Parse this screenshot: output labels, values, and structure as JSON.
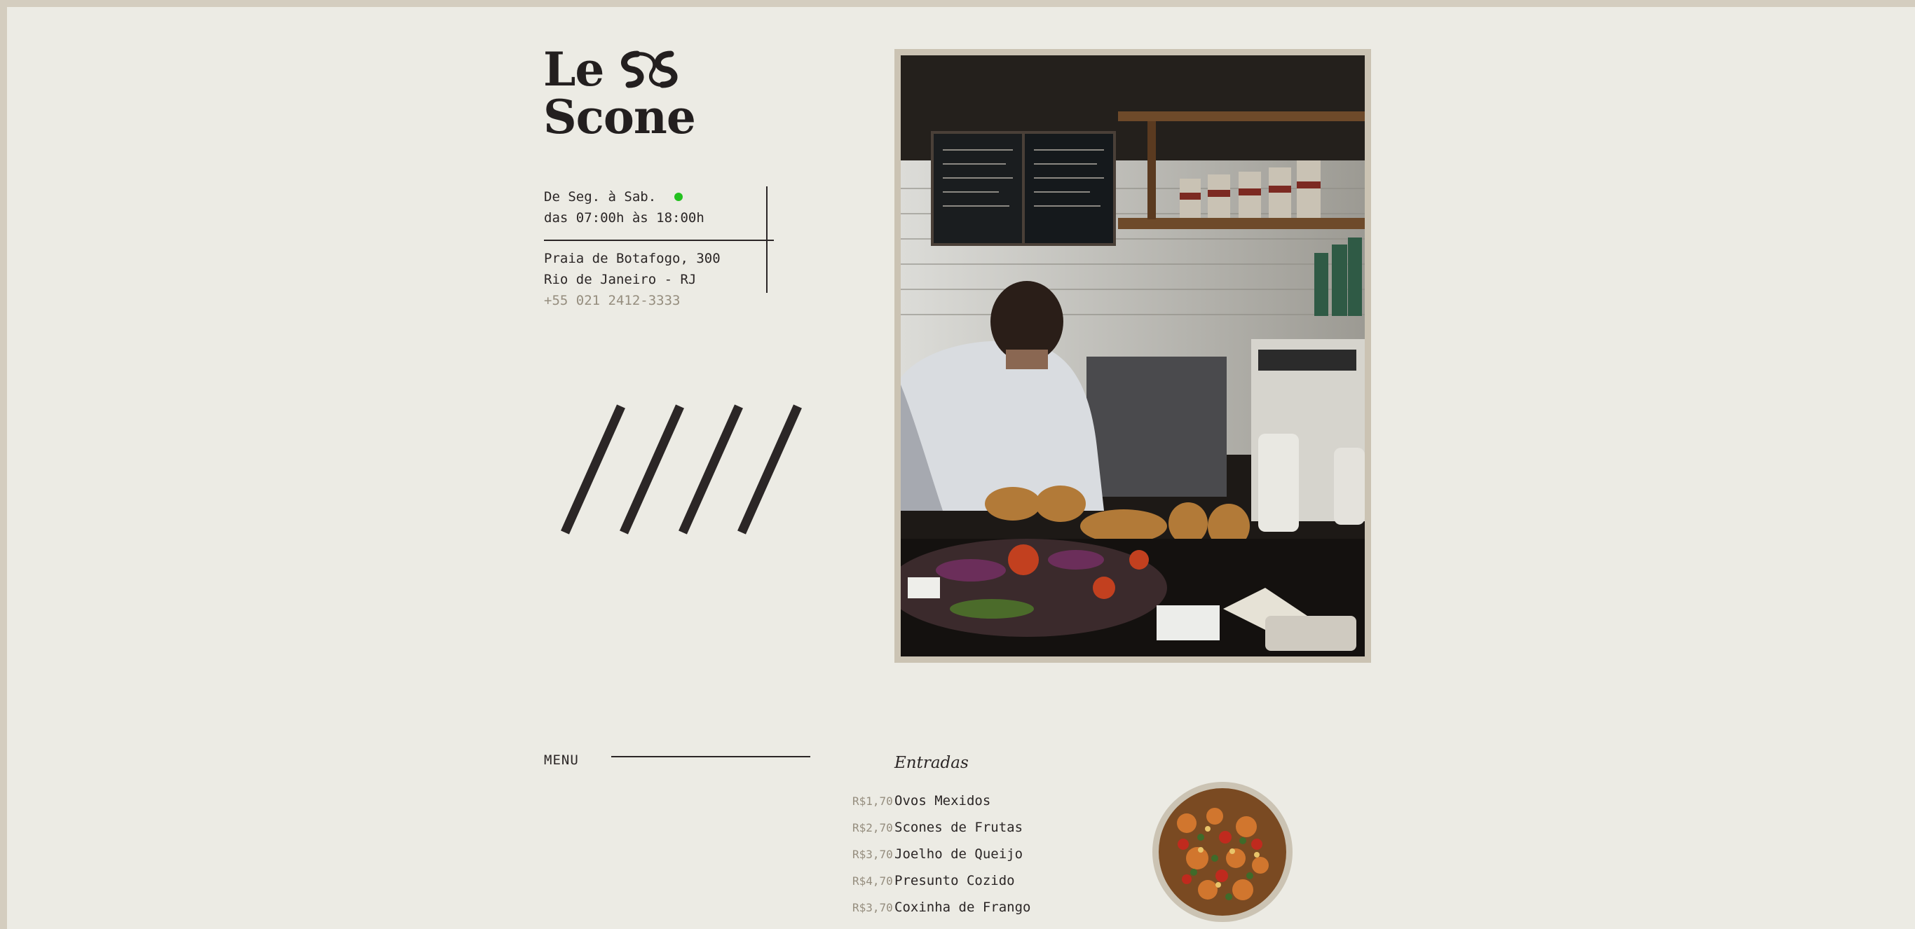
{
  "brand": {
    "line1": "Le",
    "line2": "Scone",
    "monogram_icon": "ss-monogram-icon"
  },
  "hours": {
    "days": "De Seg. à Sab.",
    "time": "das 07:00h às 18:00h",
    "status_color": "#23c11f"
  },
  "address": {
    "street": "Praia de Botafogo, 300",
    "city": "Rio de Janeiro - RJ",
    "phone": "+55 021 2412-3333"
  },
  "menu": {
    "label": "MENU",
    "section_title": "Entradas",
    "items": [
      {
        "price": "R$1,70",
        "name": "Ovos Mexidos"
      },
      {
        "price": "R$2,70",
        "name": "Scones de Frutas"
      },
      {
        "price": "R$3,70",
        "name": "Joelho de Queijo"
      },
      {
        "price": "R$4,70",
        "name": "Presunto Cozido"
      },
      {
        "price": "R$3,70",
        "name": "Coxinha de Frango"
      }
    ]
  },
  "colors": {
    "background": "#ecebe4",
    "border": "#d4cdbf",
    "ink": "#2b2626",
    "muted": "#958d7e",
    "accent_green": "#23c11f"
  },
  "icons": {
    "decor": "four-slashes-icon"
  }
}
